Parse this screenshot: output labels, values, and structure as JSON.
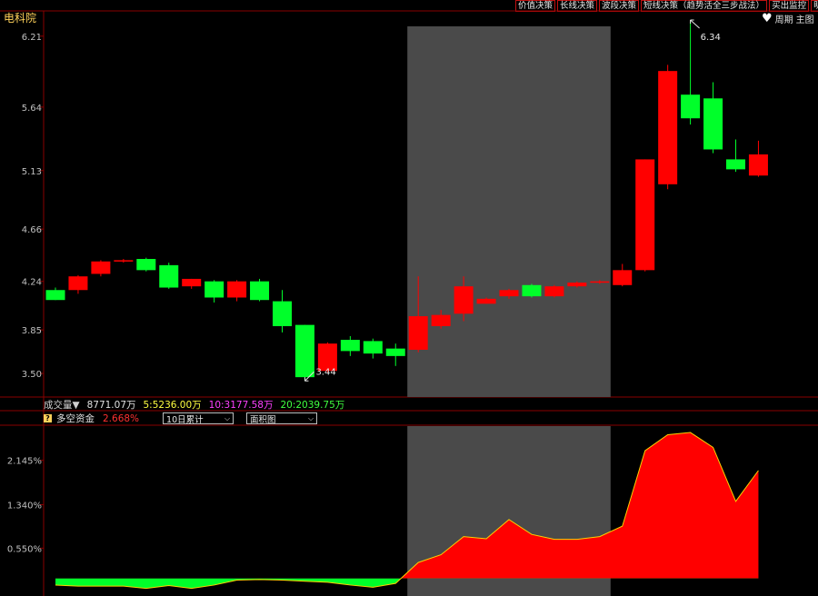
{
  "app": {
    "title": "电科院"
  },
  "toolbar": {
    "buttons": [
      "价值决策",
      "长线决策",
      "波段决策",
      "短线决策（趋势活全三步战法）",
      "买出监控",
      "明"
    ]
  },
  "period": {
    "heart_icon": "heart-icon",
    "label": "周期",
    "main_label": "主图"
  },
  "price_axis": {
    "ticks": [
      "6.21",
      "5.64",
      "5.13",
      "4.66",
      "4.24",
      "3.85",
      "3.50"
    ]
  },
  "annotations": {
    "high": "6.34",
    "low": "3.44"
  },
  "volume": {
    "label": "成交量▼",
    "value": "8771.07万",
    "ma5": "5:5236.00万",
    "ma10": "10:3177.58万",
    "ma20": "20:2039.75万"
  },
  "indicator": {
    "name": "多空资金",
    "value": "2.668%",
    "period_select": "10日累计",
    "type_select": "面积图",
    "axis_ticks": [
      "2.145%",
      "1.340%",
      "0.550%"
    ]
  },
  "colors": {
    "up": "#ff0000",
    "down": "#00ff2a",
    "grid": "#8a0000",
    "highlight": "#4a4a4a",
    "axis_text": "#c0c0c0"
  },
  "chart_data": {
    "type": "candlestick",
    "ylim": [
      3.42,
      6.34
    ],
    "candles": [
      {
        "o": 4.17,
        "c": 4.09,
        "h": 4.19,
        "l": 4.09
      },
      {
        "o": 4.17,
        "c": 4.28,
        "h": 4.29,
        "l": 4.14
      },
      {
        "o": 4.3,
        "c": 4.4,
        "h": 4.41,
        "l": 4.28
      },
      {
        "o": 4.41,
        "c": 4.41,
        "h": 4.42,
        "l": 4.39
      },
      {
        "o": 4.42,
        "c": 4.33,
        "h": 4.43,
        "l": 4.32
      },
      {
        "o": 4.37,
        "c": 4.19,
        "h": 4.39,
        "l": 4.18
      },
      {
        "o": 4.2,
        "c": 4.26,
        "h": 4.26,
        "l": 4.18
      },
      {
        "o": 4.24,
        "c": 4.11,
        "h": 4.25,
        "l": 4.07
      },
      {
        "o": 4.11,
        "c": 4.24,
        "h": 4.25,
        "l": 4.08
      },
      {
        "o": 4.24,
        "c": 4.09,
        "h": 4.26,
        "l": 4.08
      },
      {
        "o": 4.08,
        "c": 3.88,
        "h": 4.17,
        "l": 3.83
      },
      {
        "o": 3.89,
        "c": 3.47,
        "h": 3.89,
        "l": 3.44
      },
      {
        "o": 3.52,
        "c": 3.74,
        "h": 3.75,
        "l": 3.51
      },
      {
        "o": 3.77,
        "c": 3.68,
        "h": 3.8,
        "l": 3.64
      },
      {
        "o": 3.76,
        "c": 3.66,
        "h": 3.78,
        "l": 3.62
      },
      {
        "o": 3.7,
        "c": 3.64,
        "h": 3.74,
        "l": 3.56
      },
      {
        "o": 3.69,
        "c": 3.96,
        "h": 4.28,
        "l": 3.67
      },
      {
        "o": 3.88,
        "c": 3.97,
        "h": 4.01,
        "l": 3.86
      },
      {
        "o": 3.98,
        "c": 4.2,
        "h": 4.28,
        "l": 3.92
      },
      {
        "o": 4.06,
        "c": 4.1,
        "h": 4.11,
        "l": 4.06
      },
      {
        "o": 4.12,
        "c": 4.17,
        "h": 4.18,
        "l": 4.1
      },
      {
        "o": 4.21,
        "c": 4.12,
        "h": 4.22,
        "l": 4.11
      },
      {
        "o": 4.12,
        "c": 4.2,
        "h": 4.21,
        "l": 4.11
      },
      {
        "o": 4.2,
        "c": 4.23,
        "h": 4.24,
        "l": 4.19
      },
      {
        "o": 4.23,
        "c": 4.24,
        "h": 4.25,
        "l": 4.22
      },
      {
        "o": 4.21,
        "c": 4.33,
        "h": 4.38,
        "l": 4.2
      },
      {
        "o": 4.33,
        "c": 5.22,
        "h": 5.22,
        "l": 4.32
      },
      {
        "o": 5.02,
        "c": 5.93,
        "h": 5.98,
        "l": 4.98
      },
      {
        "o": 5.74,
        "c": 5.55,
        "h": 6.34,
        "l": 5.5
      },
      {
        "o": 5.71,
        "c": 5.3,
        "h": 5.84,
        "l": 5.27
      },
      {
        "o": 5.22,
        "c": 5.14,
        "h": 5.38,
        "l": 5.12
      },
      {
        "o": 5.09,
        "c": 5.26,
        "h": 5.37,
        "l": 5.08
      }
    ],
    "highlight_range": [
      16,
      24
    ],
    "indicator": {
      "name": "多空资金",
      "ylim": [
        -0.22,
        2.75
      ],
      "values": [
        -0.12,
        -0.14,
        -0.14,
        -0.14,
        -0.18,
        -0.13,
        -0.18,
        -0.12,
        -0.03,
        -0.02,
        -0.03,
        -0.05,
        -0.07,
        -0.12,
        -0.16,
        -0.09,
        0.29,
        0.43,
        0.76,
        0.72,
        1.07,
        0.8,
        0.71,
        0.71,
        0.76,
        0.95,
        2.32,
        2.61,
        2.65,
        2.38,
        1.4,
        1.96
      ]
    }
  }
}
